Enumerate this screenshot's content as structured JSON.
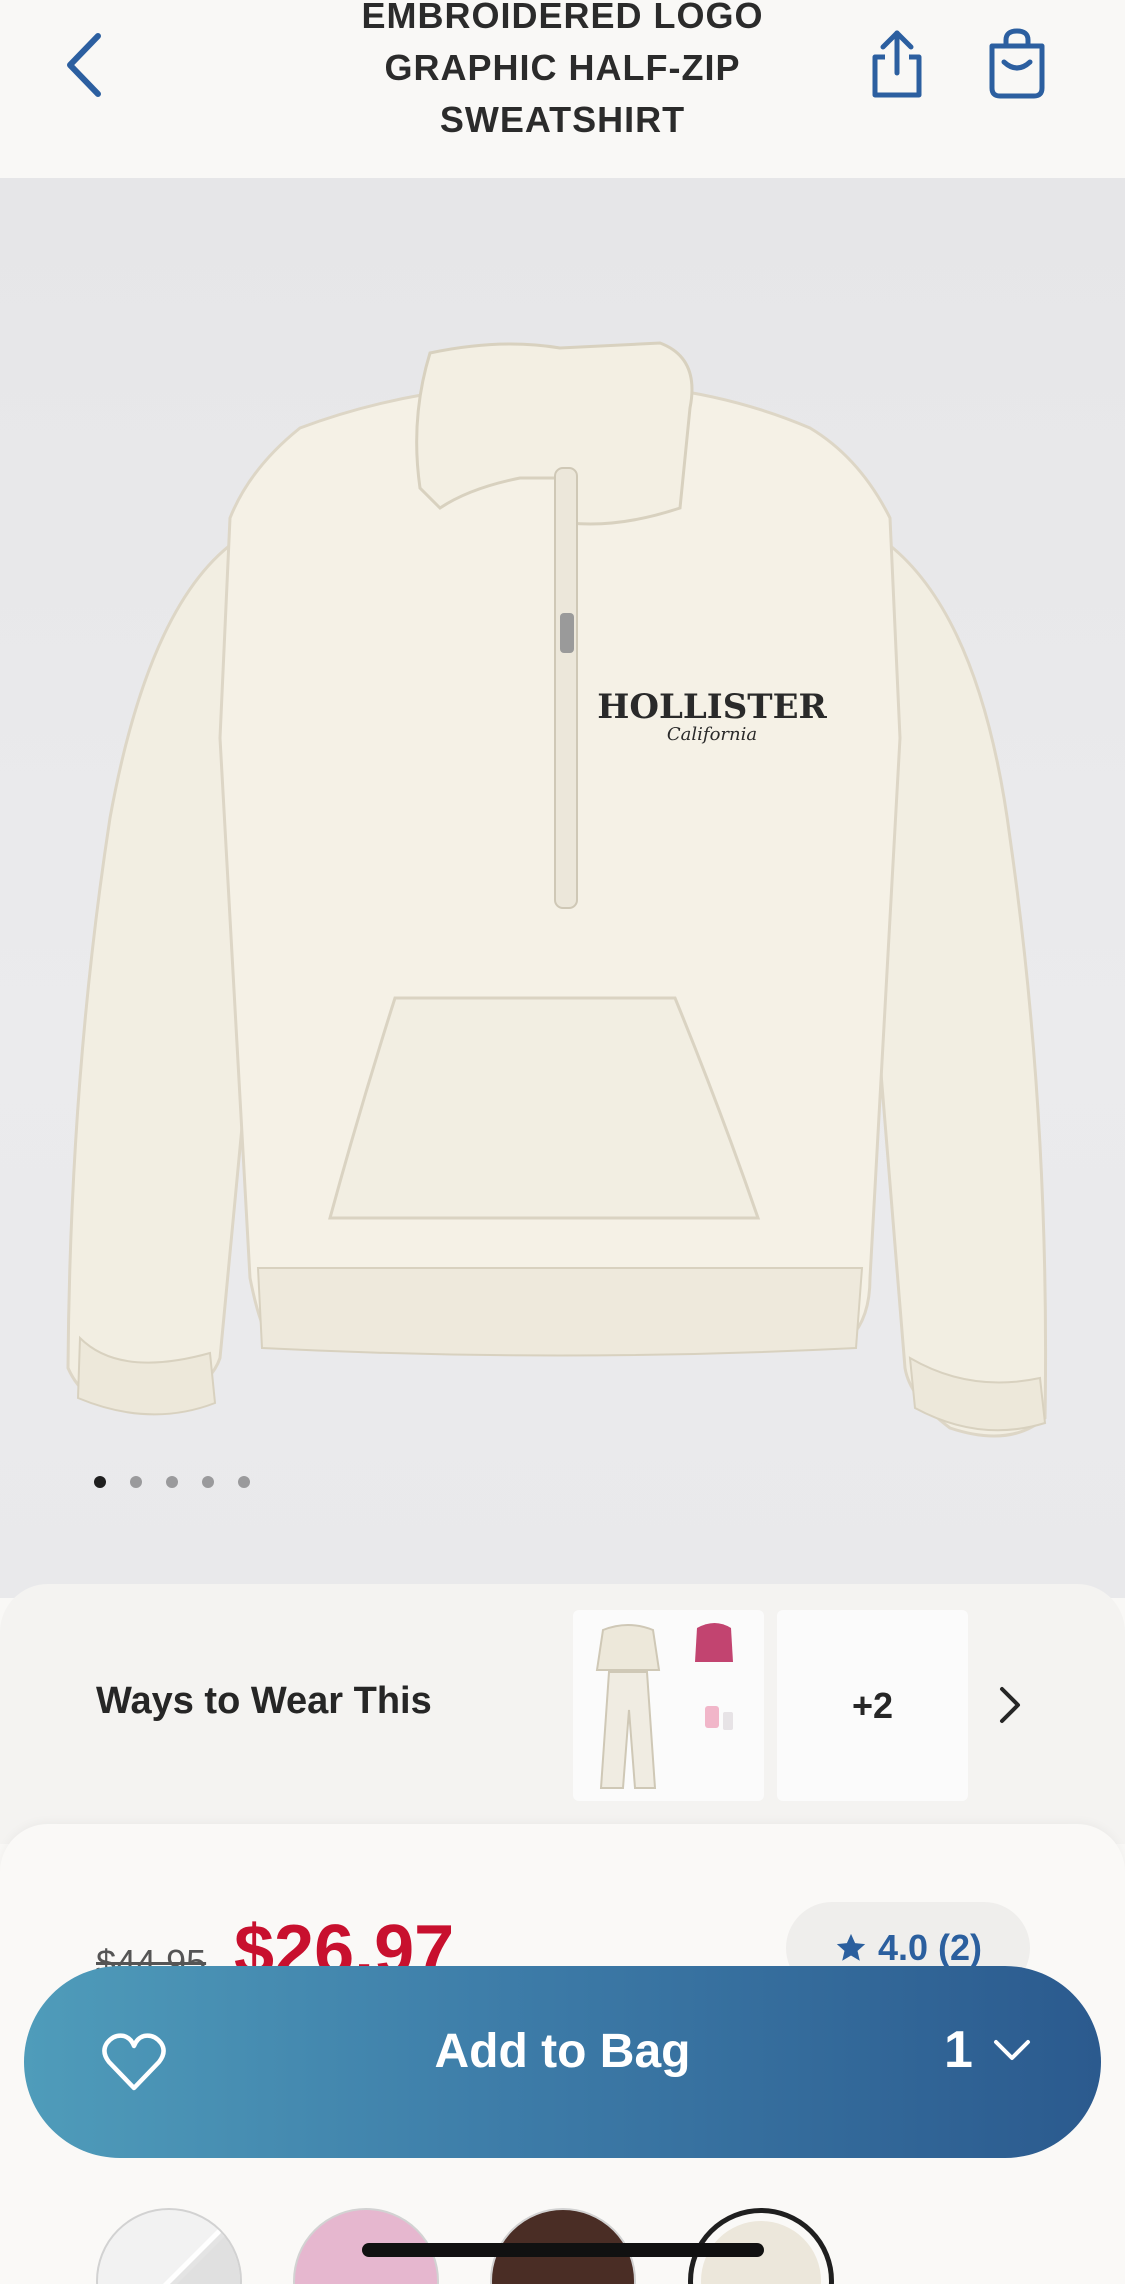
{
  "header": {
    "title": "EMBROIDERED LOGO GRAPHIC HALF-ZIP SWEATSHIRT",
    "back_icon": "chevron-left-icon",
    "share_icon": "share-icon",
    "bag_icon": "shopping-bag-icon"
  },
  "gallery": {
    "image_count": 5,
    "active_index": 0,
    "print_text": "HOLLISTER",
    "print_script": "California"
  },
  "ways_to_wear": {
    "label": "Ways to Wear This",
    "more_count": "+2"
  },
  "pricing": {
    "original": "$44.95",
    "sale": "$26.97"
  },
  "rating": {
    "value": "4.0",
    "count": "(2)"
  },
  "add_to_bag": {
    "label": "Add to Bag",
    "quantity": "1"
  },
  "colors": {
    "accent": "#2b5f9e",
    "sale": "#c8102e",
    "button_start": "#4f9cba",
    "button_end": "#2b5a8e"
  }
}
